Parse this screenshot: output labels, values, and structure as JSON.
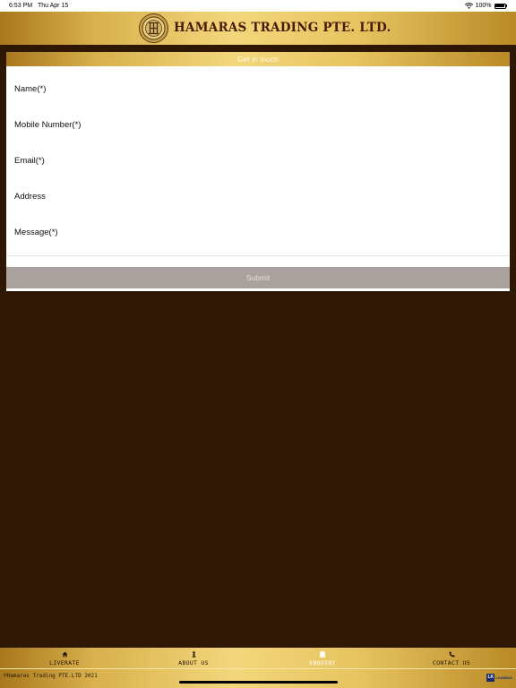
{
  "status_bar": {
    "time": "6:53 PM",
    "date": "Thu Apr 15",
    "battery": "100%"
  },
  "header": {
    "company_name": "HAMARAS TRADING PTE. LTD."
  },
  "form": {
    "title": "Get in touch",
    "fields": [
      {
        "label": "Name(*)",
        "value": ""
      },
      {
        "label": "Mobile Number(*)",
        "value": ""
      },
      {
        "label": "Email(*)",
        "value": ""
      },
      {
        "label": "Address",
        "value": ""
      },
      {
        "label": "Message(*)",
        "value": ""
      }
    ],
    "submit_label": "Submit"
  },
  "nav": {
    "items": [
      {
        "label": "LIVERATE",
        "icon": "home-icon"
      },
      {
        "label": "ABOUT US",
        "icon": "person-icon"
      },
      {
        "label": "ENQUIRY",
        "icon": "form-icon",
        "active": true
      },
      {
        "label": "CONTACT US",
        "icon": "phone-icon"
      }
    ]
  },
  "footer": {
    "copyright": "©Hamaras Trading PTE.LTD 2021",
    "brand_mark": "LK",
    "brand_text": "LOGIMAX"
  },
  "colors": {
    "background": "#2e1804",
    "gold": "#e6c35f",
    "header_text": "#4a1a06",
    "submit_bg": "#a8a19d"
  }
}
